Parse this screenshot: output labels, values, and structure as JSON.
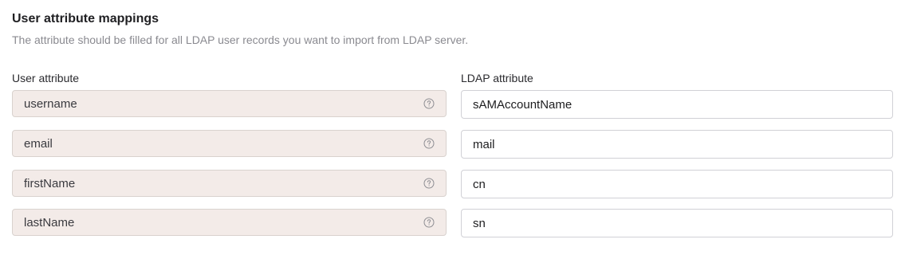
{
  "section": {
    "title": "User attribute mappings",
    "description": "The attribute should be filled for all LDAP user records you want to import from LDAP server."
  },
  "columns": {
    "user_attribute": "User attribute",
    "ldap_attribute": "LDAP attribute"
  },
  "mappings": [
    {
      "user_attribute": "username",
      "ldap_attribute": "sAMAccountName",
      "help_icon": "question-circle-icon"
    },
    {
      "user_attribute": "email",
      "ldap_attribute": "mail",
      "help_icon": "question-circle-icon"
    },
    {
      "user_attribute": "firstName",
      "ldap_attribute": "cn",
      "help_icon": "question-circle-icon"
    },
    {
      "user_attribute": "lastName",
      "ldap_attribute": "sn",
      "help_icon": "question-circle-icon"
    }
  ],
  "colors": {
    "readonly_field_bg": "#f3ebe8",
    "readonly_field_border": "#d9d2ce",
    "input_border": "#d1d1d6",
    "muted_text": "#8a8a90"
  }
}
